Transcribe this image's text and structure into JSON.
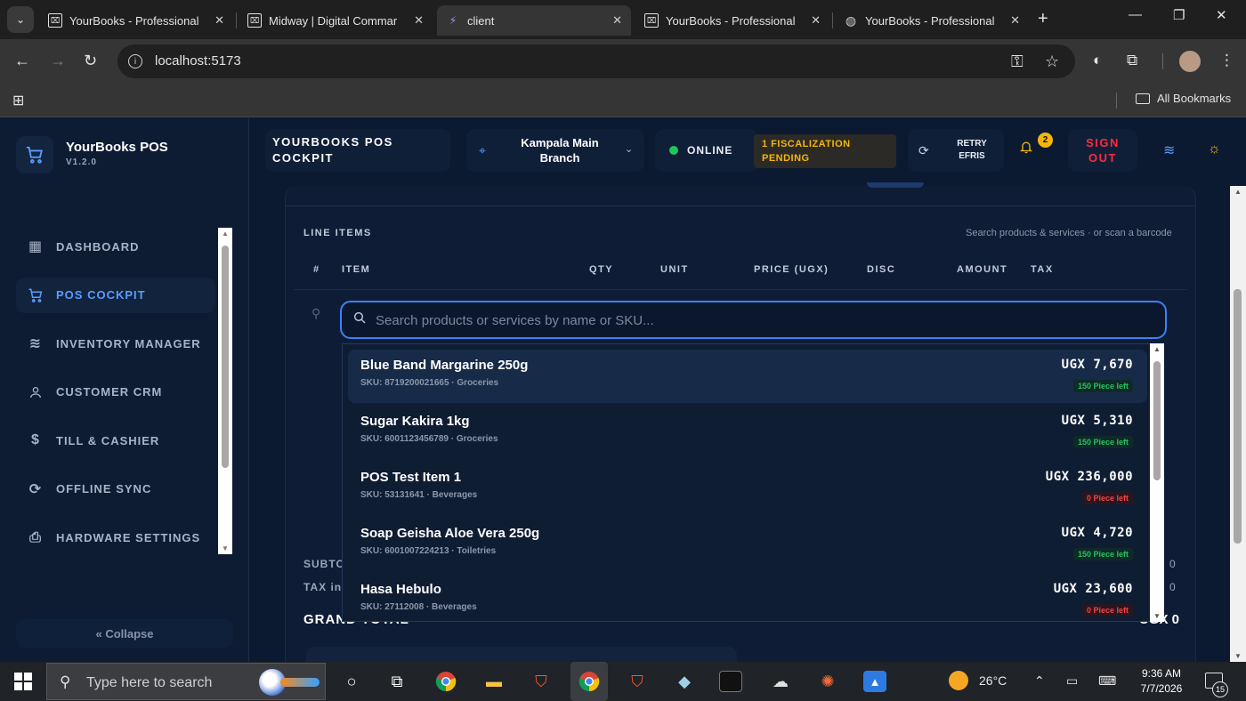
{
  "browser": {
    "tabs": [
      {
        "title": "YourBooks - Professional",
        "icon": "box-icon",
        "active": false
      },
      {
        "title": "Midway | Digital Commar",
        "icon": "box-icon",
        "active": false
      },
      {
        "title": "client",
        "icon": "vite-icon",
        "active": true
      },
      {
        "title": "YourBooks - Professional",
        "icon": "box-icon",
        "active": false
      },
      {
        "title": "YourBooks - Professional",
        "icon": "globe-icon",
        "active": false
      }
    ],
    "url": "localhost:5173",
    "bookmarks_label": "All Bookmarks"
  },
  "sidebar": {
    "brand_name": "YourBooks POS",
    "version": "V1.2.0",
    "items": [
      {
        "label": "DASHBOARD",
        "icon": "grid-icon",
        "active": false
      },
      {
        "label": "POS COCKPIT",
        "icon": "cart-icon",
        "active": true
      },
      {
        "label": "INVENTORY MANAGER",
        "icon": "layers-icon",
        "active": false
      },
      {
        "label": "CUSTOMER CRM",
        "icon": "user-icon",
        "active": false
      },
      {
        "label": "TILL & CASHIER",
        "icon": "dollar-icon",
        "active": false
      },
      {
        "label": "OFFLINE SYNC",
        "icon": "sync-icon",
        "active": false
      },
      {
        "label": "HARDWARE SETTINGS",
        "icon": "printer-icon",
        "active": false
      }
    ],
    "collapse_label": "« Collapse"
  },
  "header": {
    "title_line1": "YOURBOOKS POS",
    "title_line2": "COCKPIT",
    "branch_line1": "Kampala Main",
    "branch_line2": "Branch",
    "status": "ONLINE",
    "fiscal_line1": "1 FISCALIZATION",
    "fiscal_line2": "PENDING",
    "retry_line1": "RETRY",
    "retry_line2": "EFRIS",
    "notification_count": "2",
    "signout_line1": "SIGN",
    "signout_line2": "OUT"
  },
  "line_items": {
    "label": "LINE ITEMS",
    "hint": "Search products & services · or scan a barcode",
    "columns": [
      "#",
      "ITEM",
      "QTY",
      "UNIT",
      "PRICE (UGX)",
      "DISC",
      "AMOUNT",
      "TAX"
    ],
    "search_placeholder": "Search products or services by name or SKU..."
  },
  "results": [
    {
      "name": "Blue Band Margarine 250g",
      "meta": "SKU: 8719200021665 · Groceries",
      "price": "UGX 7,670",
      "stock": "150 Piece left",
      "in_stock": true
    },
    {
      "name": "Sugar Kakira 1kg",
      "meta": "SKU: 6001123456789 · Groceries",
      "price": "UGX 5,310",
      "stock": "150 Piece left",
      "in_stock": true
    },
    {
      "name": "POS Test Item 1",
      "meta": "SKU: 53131641 · Beverages",
      "price": "UGX 236,000",
      "stock": "0 Piece left",
      "in_stock": false
    },
    {
      "name": "Soap Geisha Aloe Vera 250g",
      "meta": "SKU: 6001007224213 · Toiletries",
      "price": "UGX 4,720",
      "stock": "150 Piece left",
      "in_stock": true
    },
    {
      "name": "Hasa Hebulo",
      "meta": "SKU: 27112008 · Beverages",
      "price": "UGX 23,600",
      "stock": "0 Piece left",
      "in_stock": false
    }
  ],
  "totals": {
    "subtotal_label": "SUBTO",
    "subtotal_value": "0",
    "tax_label": "TAX inc",
    "tax_value": "0",
    "grand_label": "GRAND TOTAL",
    "grand_value": "UGX 0"
  },
  "taskbar": {
    "search_placeholder": "Type here to search",
    "weather": "26°C",
    "time": "9:36 AM",
    "date": "7/7/2026",
    "notification_count": "15"
  },
  "colors": {
    "accent": "#3b82f6",
    "danger": "#ff2b40",
    "warning": "#f5b50a",
    "success": "#22c55e",
    "background": "#0b1a31"
  }
}
